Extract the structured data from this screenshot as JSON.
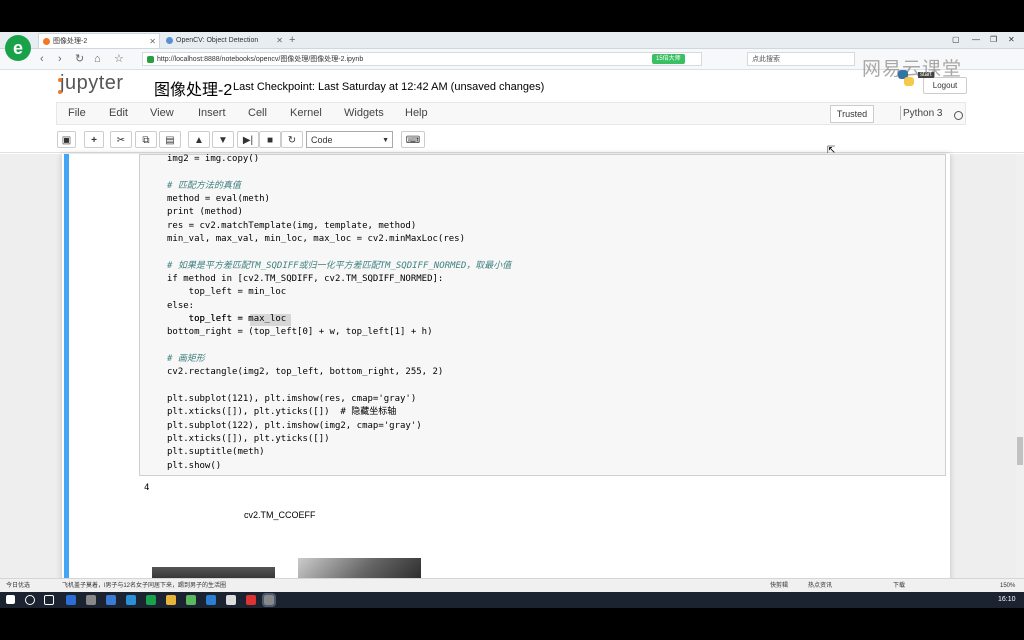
{
  "browser": {
    "tabs": [
      {
        "title": "图像处理-2",
        "active": true
      },
      {
        "title": "OpenCV: Object Detection",
        "active": false
      }
    ],
    "url": "http://localhost:8888/notebooks/opencv/图像处理/图像处理-2.ipynb",
    "green_badge": "15倍大师",
    "search_placeholder": "点此搜索"
  },
  "watermark": {
    "text": "网易云课堂",
    "mini_label": "start"
  },
  "jupyter": {
    "logo": "jupyter",
    "notebook_title": "图像处理-2",
    "checkpoint": "Last Checkpoint: Last Saturday at 12:42 AM (unsaved changes)",
    "logout": "Logout",
    "menu": [
      "File",
      "Edit",
      "View",
      "Insert",
      "Cell",
      "Kernel",
      "Widgets",
      "Help"
    ],
    "trusted": "Trusted",
    "kernel_name": "Python 3",
    "cell_type": "Code"
  },
  "code_lines": [
    "img2 = img.copy()",
    "",
    "# 匹配方法的真值",
    "method = eval(meth)",
    "print (method)",
    "res = cv2.matchTemplate(img, template, method)",
    "min_val, max_val, min_loc, max_loc = cv2.minMaxLoc(res)",
    "",
    "# 如果是平方差匹配TM_SQDIFF或归一化平方差匹配TM_SQDIFF_NORMED，取最小值",
    "if method in [cv2.TM_SQDIFF, cv2.TM_SQDIFF_NORMED]:",
    "    top_left = min_loc",
    "else:",
    "    top_left = max_loc",
    "bottom_right = (top_left[0] + w, top_left[1] + h)",
    "",
    "# 画矩形",
    "cv2.rectangle(img2, top_left, bottom_right, 255, 2)",
    "",
    "plt.subplot(121), plt.imshow(res, cmap='gray')",
    "plt.xticks([]), plt.yticks([])  # 隐藏坐标轴",
    "plt.subplot(122), plt.imshow(img2, cmap='gray')",
    "plt.xticks([]), plt.yticks([])",
    "plt.suptitle(meth)",
    "plt.show()"
  ],
  "output": {
    "printed": "4",
    "suptitle": "cv2.TM_CCOEFF"
  },
  "statusbar": {
    "left": "今日优选",
    "news": "飞机盖子莫着，l男子与12名女子同居下来，踢到男子的生活圈",
    "items": [
      "快剪辑",
      "热点资讯",
      "下载",
      "150%"
    ]
  },
  "taskbar": {
    "time": "16:10"
  }
}
